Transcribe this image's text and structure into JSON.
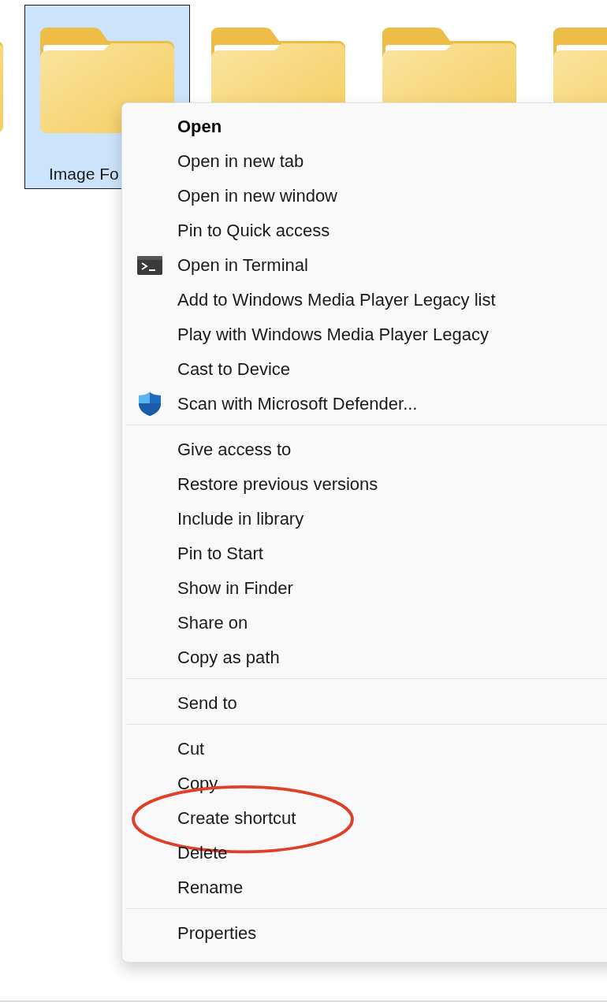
{
  "folders": [
    {
      "selected": false
    },
    {
      "label": "Image Fo",
      "selected": true
    },
    {
      "selected": false
    },
    {
      "selected": false
    },
    {
      "selected": false
    }
  ],
  "context_menu": {
    "groups": [
      {
        "items": [
          {
            "label": "Open",
            "kind": "plain",
            "default": true
          },
          {
            "label": "Open in new tab",
            "kind": "plain",
            "default": false
          },
          {
            "label": "Open in new window",
            "kind": "plain",
            "default": false
          },
          {
            "label": "Pin to Quick access",
            "kind": "plain",
            "default": false
          },
          {
            "label": "Open in Terminal",
            "kind": "terminal",
            "default": false
          },
          {
            "label": "Add to Windows Media Player Legacy list",
            "kind": "plain",
            "default": false
          },
          {
            "label": "Play with Windows Media Player Legacy",
            "kind": "plain",
            "default": false
          },
          {
            "label": "Cast to Device",
            "kind": "plain",
            "default": false
          },
          {
            "label": "Scan with Microsoft Defender...",
            "kind": "shield",
            "default": false
          }
        ]
      },
      {
        "items": [
          {
            "label": "Give access to",
            "kind": "plain",
            "default": false
          },
          {
            "label": "Restore previous versions",
            "kind": "plain",
            "default": false
          },
          {
            "label": "Include in library",
            "kind": "plain",
            "default": false
          },
          {
            "label": "Pin to Start",
            "kind": "plain",
            "default": false
          },
          {
            "label": "Show in Finder",
            "kind": "plain",
            "default": false
          },
          {
            "label": "Share on",
            "kind": "plain",
            "default": false
          },
          {
            "label": "Copy as path",
            "kind": "plain",
            "default": false
          }
        ]
      },
      {
        "items": [
          {
            "label": "Send to",
            "kind": "plain",
            "default": false
          }
        ]
      },
      {
        "items": [
          {
            "label": "Cut",
            "kind": "plain",
            "default": false
          },
          {
            "label": "Copy",
            "kind": "plain",
            "default": false
          },
          {
            "label": "Create shortcut",
            "kind": "plain",
            "default": false,
            "circled": true
          },
          {
            "label": "Delete",
            "kind": "plain",
            "default": false
          },
          {
            "label": "Rename",
            "kind": "plain",
            "default": false
          }
        ]
      },
      {
        "items": [
          {
            "label": "Properties",
            "kind": "plain",
            "default": false
          }
        ]
      }
    ]
  }
}
